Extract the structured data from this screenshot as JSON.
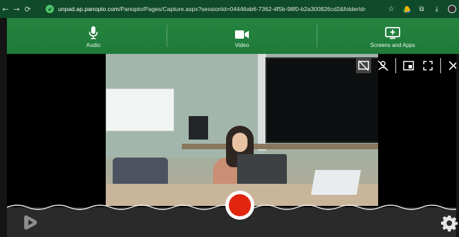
{
  "browser": {
    "url_host": "unpad.ap.panopto.com",
    "url_rest": "/Panopto/Pages/Capture.aspx?sessionId=04446ab6-7362-4f5b-98f0-b2a300826cd2&folderId=5751e454-6ad4-417..."
  },
  "toolbar": {
    "items": [
      {
        "label": "Audio",
        "icon": "microphone-icon"
      },
      {
        "label": "Video",
        "icon": "video-camera-icon"
      },
      {
        "label": "Screens and Apps",
        "icon": "screen-share-icon"
      }
    ]
  },
  "colors": {
    "toolbar_green": "#24843f",
    "record_red": "#e0260f",
    "browser_bar": "#0f4a2a"
  },
  "overlay_icons": [
    "no-screen-icon",
    "no-person-icon",
    "picture-in-picture-icon",
    "fullscreen-icon",
    "close-icon"
  ]
}
